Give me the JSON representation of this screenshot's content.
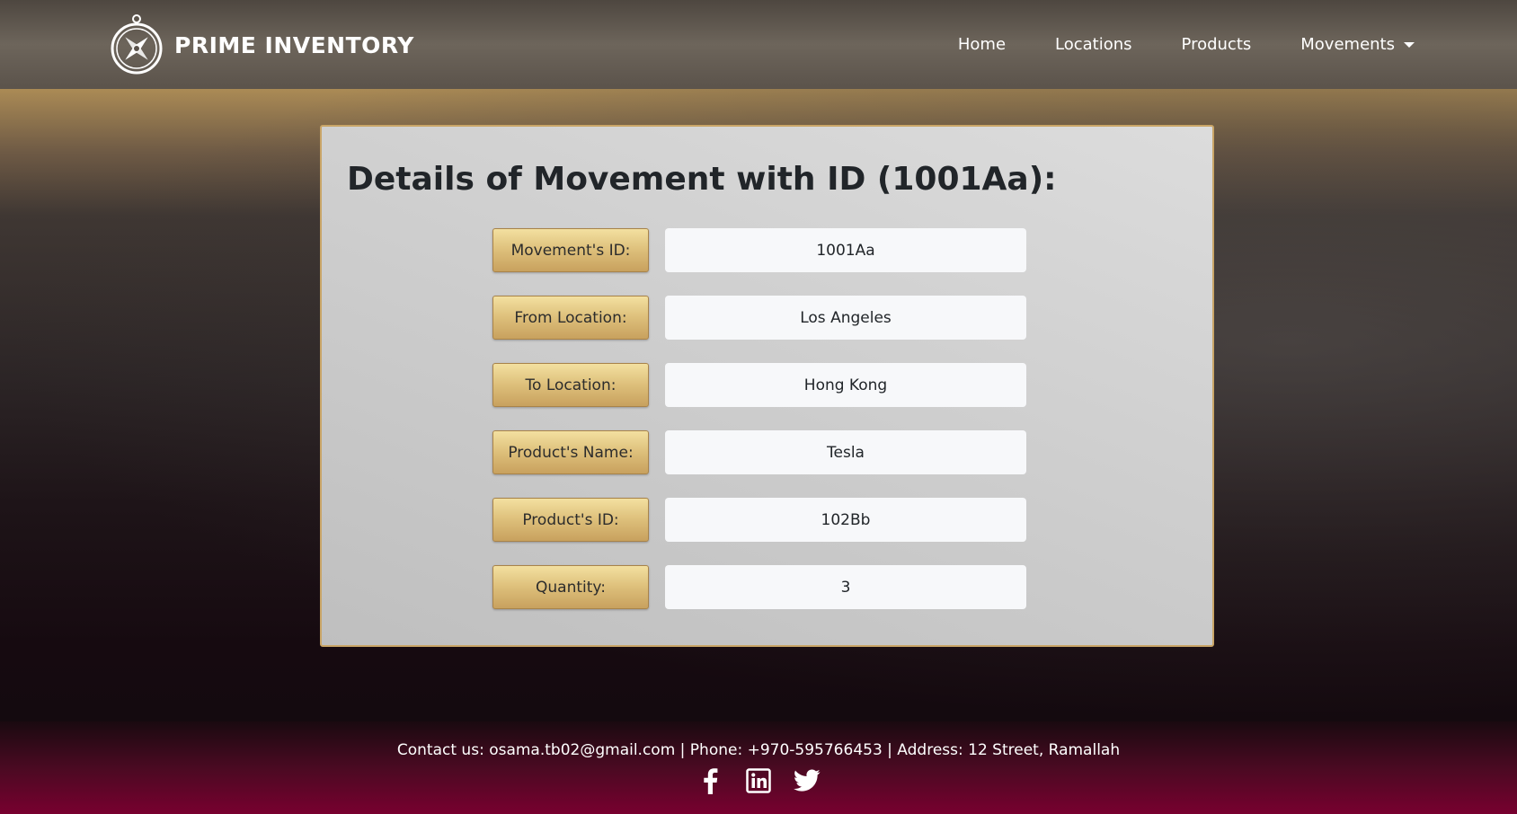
{
  "navbar": {
    "brand_name": "PRIME INVENTORY",
    "logo_icon": "compass-icon",
    "links": [
      {
        "label": "Home"
      },
      {
        "label": "Locations"
      },
      {
        "label": "Products"
      },
      {
        "label": "Movements",
        "has_dropdown": true
      }
    ]
  },
  "card": {
    "title": "Details of Movement with ID (1001Aa):",
    "fields": [
      {
        "label": "Movement's ID:",
        "value": "1001Aa"
      },
      {
        "label": "From Location:",
        "value": "Los Angeles"
      },
      {
        "label": "To Location:",
        "value": "Hong Kong"
      },
      {
        "label": "Product's Name:",
        "value": "Tesla"
      },
      {
        "label": "Product's ID:",
        "value": "102Bb"
      },
      {
        "label": "Quantity:",
        "value": "3"
      }
    ]
  },
  "footer": {
    "contact_text": "Contact us: osama.tb02@gmail.com | Phone: +970-595766453 | Address: 12 Street, Ramallah",
    "social_icons": [
      "facebook-icon",
      "linkedin-icon",
      "twitter-icon"
    ]
  },
  "colors": {
    "label_gold": "#ddbf7a",
    "card_border": "#c9a567",
    "footer_crimson": "#78002f",
    "navbar_brown": "#6d655b"
  }
}
